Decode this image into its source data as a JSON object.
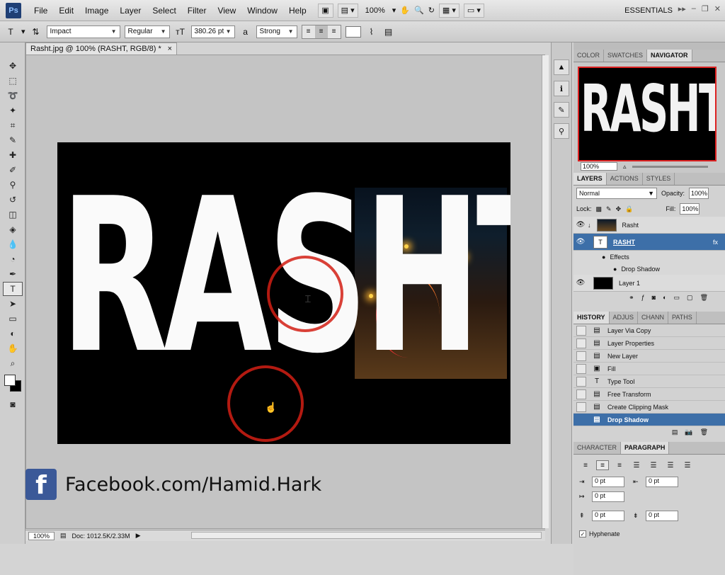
{
  "app": {
    "logo": "Ps",
    "workspace": "ESSENTIALS",
    "zoom_menu": "100%"
  },
  "menu": [
    "File",
    "Edit",
    "Image",
    "Layer",
    "Select",
    "Filter",
    "View",
    "Window",
    "Help"
  ],
  "options": {
    "tool_glyph": "T",
    "font_family": "Impact",
    "font_style": "Regular",
    "font_size": "380.26 pt",
    "aa_label": "a",
    "anti_alias": "Strong"
  },
  "document": {
    "tab_title": "Rasht.jpg @ 100% (RASHT, RGB/8) *",
    "tab_close": "×",
    "canvas_text": "RASHT",
    "zoom": "100%",
    "doc_info": "Doc: 1012.5K/2.33M"
  },
  "overlay": {
    "facebook_glyph": "f",
    "facebook_text": "Facebook.com/Hamid.Hark"
  },
  "navigator": {
    "tabs": [
      "COLOR",
      "SWATCHES",
      "NAVIGATOR"
    ],
    "zoom": "100%",
    "preview_text": "RASHT"
  },
  "layers": {
    "tabs": [
      "LAYERS",
      "ACTIONS",
      "STYLES"
    ],
    "blend_mode": "Normal",
    "opacity_label": "Opacity:",
    "opacity": "100%",
    "lock_label": "Lock:",
    "fill_label": "Fill:",
    "fill": "100%",
    "items": [
      {
        "name": "Rasht"
      },
      {
        "name": "RASHT",
        "fx": "fx"
      },
      {
        "name": "Effects"
      },
      {
        "name": "Drop Shadow"
      },
      {
        "name": "Layer 1"
      }
    ]
  },
  "history": {
    "tabs": [
      "HISTORY",
      "ADJUS",
      "CHANN",
      "PATHS"
    ],
    "items": [
      "Layer Via Copy",
      "Layer Properties",
      "New Layer",
      "Fill",
      "Type Tool",
      "Free Transform",
      "Create Clipping Mask",
      "Drop Shadow"
    ]
  },
  "paragraph": {
    "tabs": [
      "CHARACTER",
      "PARAGRAPH"
    ],
    "indent_left": "0 pt",
    "indent_right": "0 pt",
    "first_line": "0 pt",
    "space_before": "0 pt",
    "space_after": "0 pt",
    "hyphenate_label": "Hyphenate",
    "hyphenate_checked": true
  },
  "colors": {
    "selection": "#3d6fa8",
    "highlight_circle": "#d21e14",
    "facebook": "#3b5998"
  }
}
